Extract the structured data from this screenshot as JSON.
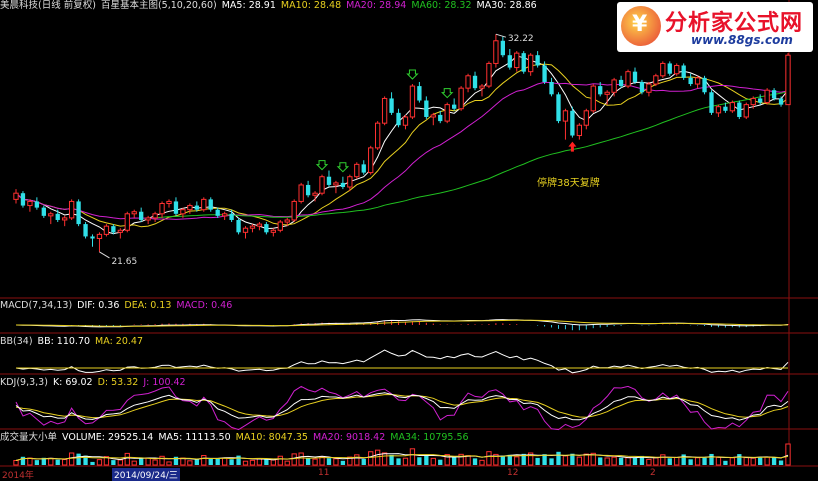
{
  "header": {
    "stock_title": "美晨科技(日线 前复权)",
    "indicator_name": "百星基本主图(5,10,20,60)",
    "ma5": {
      "label": "MA5: 28.91",
      "color": "#ffffff"
    },
    "ma10": {
      "label": "MA10: 28.48",
      "color": "#e8d020"
    },
    "ma20": {
      "label": "MA20: 28.94",
      "color": "#d020d0"
    },
    "ma60": {
      "label": "MA60: 28.32",
      "color": "#20c020"
    },
    "ma30": {
      "label": "MA30: 28.86",
      "color": "#ffffff"
    }
  },
  "panels": {
    "macd": {
      "name": "MACD(7,34,13)",
      "dif": "DIF: 0.36",
      "dea": "DEA: 0.13",
      "macd": "MACD: 0.46"
    },
    "bb": {
      "name": "BB(34)",
      "bb": "BB: 110.70",
      "ma": "MA: 20.47"
    },
    "kdj": {
      "name": "KDJ(9,3,3)",
      "k": "K: 69.02",
      "d": "D: 53.32",
      "j": "J: 100.42"
    },
    "volume": {
      "name": "成交量大小单",
      "volume": "VOLUME: 29525.14",
      "ma5": "MA5: 11113.50",
      "ma10": "MA10: 8047.35",
      "ma20": "MA20: 9018.42",
      "ma34": "MA34: 10795.56"
    }
  },
  "logo": {
    "brand": "分析家公式网",
    "url": "www.88gs.com"
  },
  "annotations": {
    "suspension": "停牌38天复牌",
    "high_label": "32.22",
    "low_label": "21.65"
  },
  "x_labels": [
    "2014年",
    "2014/09/24/三",
    "11",
    "12",
    "2"
  ],
  "chart_data": {
    "type": "candlestick",
    "ylim": [
      19.8,
      33.2
    ],
    "candles": [
      [
        24.2,
        24.7,
        24.0,
        24.5
      ],
      [
        24.5,
        24.6,
        23.8,
        23.9
      ],
      [
        23.9,
        24.2,
        23.6,
        24.1
      ],
      [
        24.1,
        24.3,
        23.7,
        23.8
      ],
      [
        23.8,
        23.9,
        23.3,
        23.4
      ],
      [
        23.4,
        23.6,
        23.0,
        23.5
      ],
      [
        23.5,
        23.7,
        23.1,
        23.2
      ],
      [
        23.2,
        23.4,
        22.9,
        23.3
      ],
      [
        23.3,
        24.2,
        23.2,
        24.1
      ],
      [
        24.1,
        24.2,
        22.9,
        23.0
      ],
      [
        23.0,
        23.1,
        22.3,
        22.4
      ],
      [
        22.4,
        22.5,
        21.9,
        22.3
      ],
      [
        22.3,
        22.6,
        21.65,
        22.5
      ],
      [
        22.5,
        23.0,
        22.4,
        22.9
      ],
      [
        22.9,
        23.0,
        22.5,
        22.6
      ],
      [
        22.6,
        22.8,
        22.3,
        22.7
      ],
      [
        22.7,
        23.6,
        22.6,
        23.5
      ],
      [
        23.5,
        23.7,
        23.3,
        23.6
      ],
      [
        23.6,
        23.8,
        23.1,
        23.2
      ],
      [
        23.2,
        23.4,
        23.0,
        23.3
      ],
      [
        23.3,
        23.6,
        23.1,
        23.5
      ],
      [
        23.5,
        24.1,
        23.3,
        24.0
      ],
      [
        24.0,
        24.2,
        23.8,
        24.1
      ],
      [
        24.1,
        24.3,
        23.4,
        23.5
      ],
      [
        23.5,
        23.8,
        23.3,
        23.7
      ],
      [
        23.7,
        24.0,
        23.5,
        23.9
      ],
      [
        23.9,
        24.1,
        23.6,
        23.7
      ],
      [
        23.7,
        24.3,
        23.6,
        24.2
      ],
      [
        24.2,
        24.3,
        23.6,
        23.7
      ],
      [
        23.7,
        23.8,
        23.3,
        23.4
      ],
      [
        23.4,
        23.6,
        23.2,
        23.5
      ],
      [
        23.5,
        23.7,
        23.1,
        23.2
      ],
      [
        23.2,
        23.3,
        22.5,
        22.6
      ],
      [
        22.6,
        22.9,
        22.3,
        22.8
      ],
      [
        22.8,
        23.0,
        22.6,
        22.9
      ],
      [
        22.9,
        23.1,
        22.7,
        23.0
      ],
      [
        23.0,
        23.1,
        22.5,
        22.6
      ],
      [
        22.6,
        22.8,
        22.4,
        22.7
      ],
      [
        22.7,
        23.2,
        22.6,
        23.1
      ],
      [
        23.1,
        23.3,
        22.9,
        23.2
      ],
      [
        23.2,
        24.2,
        23.1,
        24.1
      ],
      [
        24.1,
        25.0,
        24.0,
        24.9
      ],
      [
        24.9,
        25.1,
        24.3,
        24.4
      ],
      [
        24.4,
        24.6,
        24.1,
        24.5
      ],
      [
        24.5,
        25.4,
        24.4,
        25.3
      ],
      [
        25.3,
        25.6,
        24.8,
        24.9
      ],
      [
        24.9,
        25.1,
        24.5,
        25.0
      ],
      [
        25.0,
        25.3,
        24.7,
        24.8
      ],
      [
        24.8,
        25.4,
        24.6,
        25.3
      ],
      [
        25.3,
        26.0,
        25.2,
        25.9
      ],
      [
        25.9,
        26.1,
        25.4,
        25.5
      ],
      [
        25.5,
        26.8,
        25.4,
        26.7
      ],
      [
        26.7,
        28.0,
        26.6,
        27.9
      ],
      [
        27.9,
        29.2,
        27.8,
        29.1
      ],
      [
        29.1,
        29.4,
        28.3,
        28.4
      ],
      [
        28.4,
        28.6,
        27.7,
        27.8
      ],
      [
        27.8,
        28.3,
        27.6,
        28.2
      ],
      [
        28.2,
        29.8,
        28.1,
        29.7
      ],
      [
        29.7,
        29.9,
        28.9,
        29.0
      ],
      [
        29.0,
        29.2,
        28.1,
        28.2
      ],
      [
        28.2,
        28.4,
        27.8,
        28.3
      ],
      [
        28.3,
        28.5,
        27.9,
        28.0
      ],
      [
        28.0,
        28.9,
        27.9,
        28.8
      ],
      [
        28.8,
        29.1,
        28.5,
        28.6
      ],
      [
        28.6,
        29.7,
        28.5,
        29.6
      ],
      [
        29.6,
        30.3,
        29.4,
        30.2
      ],
      [
        30.2,
        30.4,
        29.5,
        29.6
      ],
      [
        29.6,
        29.8,
        29.2,
        29.7
      ],
      [
        29.7,
        30.9,
        29.6,
        30.8
      ],
      [
        30.8,
        32.22,
        30.6,
        31.9
      ],
      [
        31.9,
        32.1,
        31.1,
        31.2
      ],
      [
        31.2,
        31.5,
        30.5,
        30.6
      ],
      [
        30.6,
        31.4,
        30.4,
        31.3
      ],
      [
        31.3,
        31.4,
        30.3,
        30.4
      ],
      [
        30.4,
        31.3,
        30.2,
        31.2
      ],
      [
        31.2,
        31.4,
        30.6,
        30.7
      ],
      [
        30.7,
        30.9,
        29.8,
        29.9
      ],
      [
        29.9,
        30.1,
        29.2,
        29.3
      ],
      [
        29.3,
        29.4,
        27.9,
        28.0
      ],
      [
        28.0,
        28.6,
        27.1,
        28.5
      ],
      [
        28.5,
        28.7,
        27.2,
        27.3
      ],
      [
        27.3,
        27.9,
        27.1,
        27.8
      ],
      [
        27.8,
        28.6,
        27.6,
        28.5
      ],
      [
        28.5,
        29.8,
        28.4,
        29.7
      ],
      [
        29.7,
        29.9,
        29.2,
        29.3
      ],
      [
        29.3,
        29.5,
        28.8,
        29.4
      ],
      [
        29.4,
        30.1,
        29.2,
        30.0
      ],
      [
        30.0,
        30.2,
        29.6,
        29.7
      ],
      [
        29.7,
        30.5,
        29.6,
        30.4
      ],
      [
        30.4,
        30.6,
        29.8,
        29.9
      ],
      [
        29.9,
        30.0,
        29.3,
        29.4
      ],
      [
        29.4,
        29.9,
        29.2,
        29.8
      ],
      [
        29.8,
        30.3,
        29.7,
        30.2
      ],
      [
        30.2,
        30.9,
        30.1,
        30.8
      ],
      [
        30.8,
        30.9,
        30.2,
        30.3
      ],
      [
        30.3,
        30.8,
        30.2,
        30.7
      ],
      [
        30.7,
        30.8,
        30.0,
        30.1
      ],
      [
        30.1,
        30.3,
        29.7,
        29.8
      ],
      [
        29.8,
        30.2,
        29.6,
        30.1
      ],
      [
        30.1,
        30.2,
        29.3,
        29.4
      ],
      [
        29.4,
        29.5,
        28.3,
        28.4
      ],
      [
        28.4,
        28.8,
        28.2,
        28.7
      ],
      [
        28.7,
        28.9,
        28.4,
        28.5
      ],
      [
        28.5,
        29.0,
        28.4,
        28.9
      ],
      [
        28.9,
        29.0,
        28.1,
        28.2
      ],
      [
        28.2,
        28.9,
        28.1,
        28.8
      ],
      [
        28.8,
        29.2,
        28.6,
        29.1
      ],
      [
        29.1,
        29.3,
        28.8,
        28.9
      ],
      [
        28.9,
        29.6,
        28.8,
        29.5
      ],
      [
        29.5,
        29.6,
        29.0,
        29.1
      ],
      [
        29.1,
        29.2,
        28.7,
        28.8
      ],
      [
        28.8,
        31.3,
        28.8,
        31.2
      ]
    ],
    "gap_after_index": 79,
    "ma_periods": [
      5,
      10,
      20,
      60
    ],
    "markers_up_index": [
      44,
      47,
      57,
      62
    ],
    "markers_down_index": [
      80
    ]
  }
}
